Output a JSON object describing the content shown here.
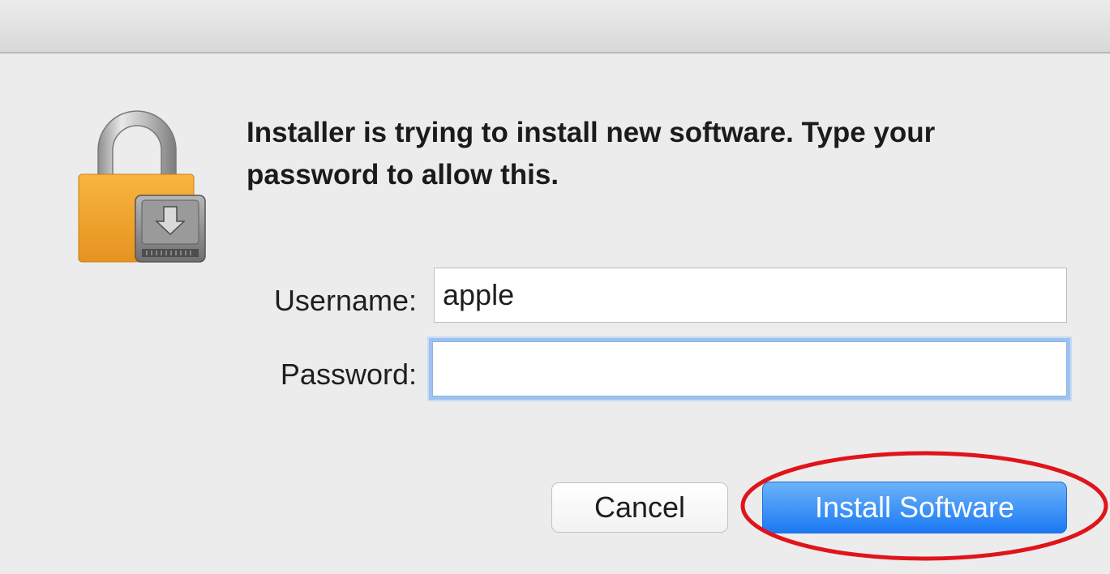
{
  "dialog": {
    "message": "Installer is trying to install new software. Type your password to allow this.",
    "icon": "lock-installer-icon"
  },
  "form": {
    "username_label": "Username:",
    "username_value": "apple",
    "password_label": "Password:",
    "password_value": ""
  },
  "buttons": {
    "cancel_label": "Cancel",
    "install_label": "Install Software"
  },
  "colors": {
    "primary_button": "#1b79f3",
    "focus_ring": "#9ec2f0",
    "annotation_ellipse": "#e0141b",
    "lock_body": "#f4a52b"
  }
}
